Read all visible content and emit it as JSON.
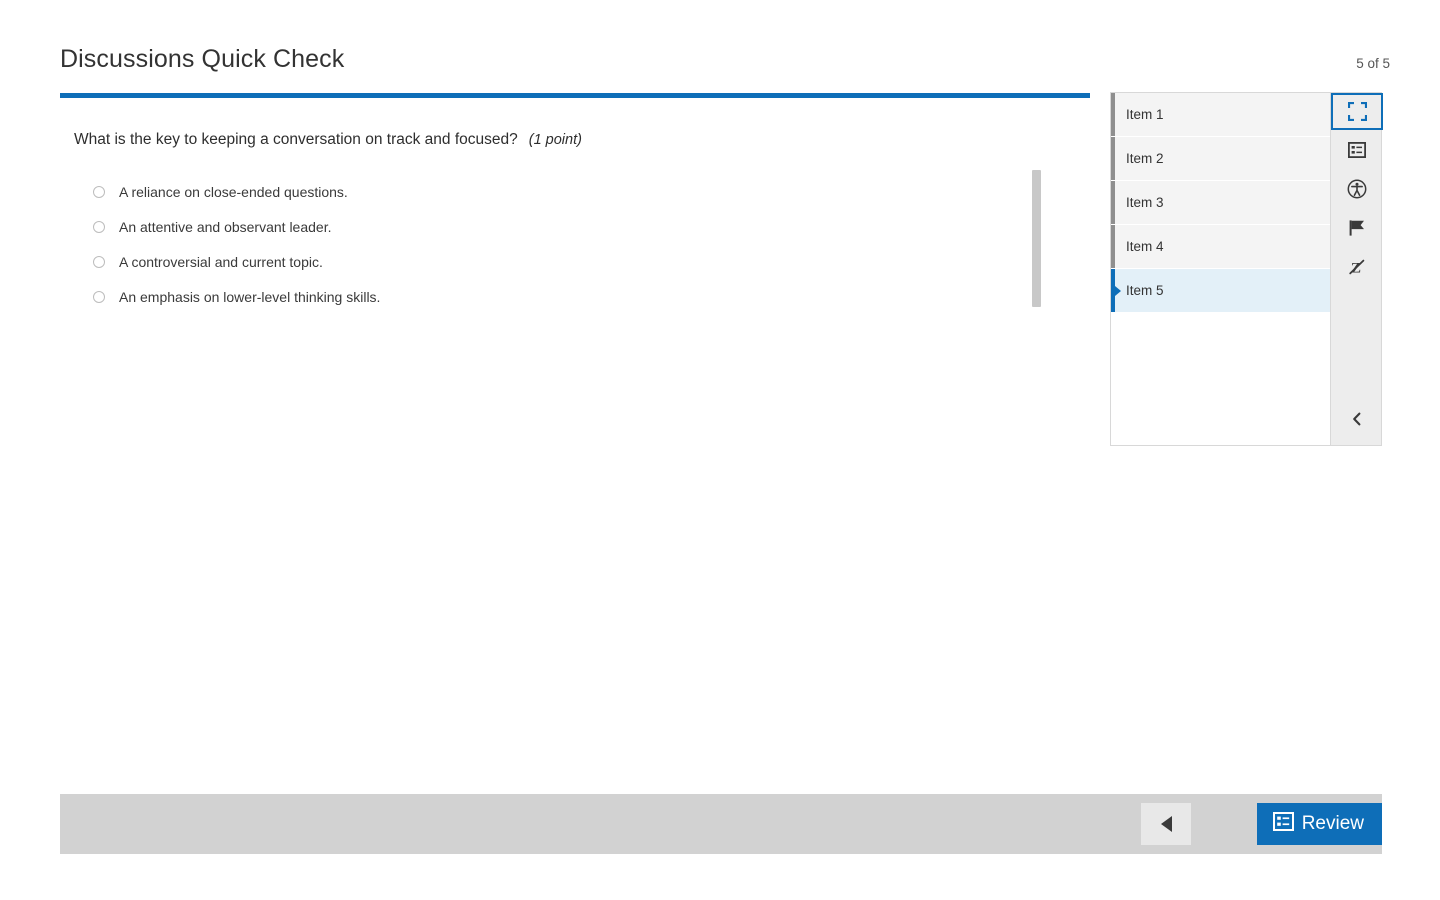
{
  "header": {
    "title": "Discussions Quick Check",
    "counter": "5 of 5"
  },
  "question": {
    "text": "What is the key to keeping a conversation on track and focused?",
    "points": "(1 point)",
    "options": [
      {
        "label": "A reliance on close-ended questions.",
        "selected": false
      },
      {
        "label": "An attentive and observant leader.",
        "selected": false
      },
      {
        "label": "A controversial and current topic.",
        "selected": false
      },
      {
        "label": "An emphasis on lower-level thinking skills.",
        "selected": false
      }
    ]
  },
  "nav_panel": {
    "items": [
      {
        "label": "Item 1",
        "selected": false
      },
      {
        "label": "Item 2",
        "selected": false
      },
      {
        "label": "Item 3",
        "selected": false
      },
      {
        "label": "Item 4",
        "selected": false
      },
      {
        "label": "Item 5",
        "selected": true
      }
    ],
    "tools": [
      {
        "name": "fullscreen-icon",
        "active": true
      },
      {
        "name": "review-list-icon",
        "active": false
      },
      {
        "name": "accessibility-icon",
        "active": false
      },
      {
        "name": "flag-icon",
        "active": false
      },
      {
        "name": "strikethrough-icon",
        "active": false
      }
    ],
    "collapse_icon": "chevron-left-icon"
  },
  "bottom_bar": {
    "prev_icon": "triangle-left-icon",
    "review_icon": "review-list-icon",
    "review_label": "Review"
  },
  "colors": {
    "accent": "#0E6EB8",
    "selected_row": "#E3F0F8",
    "bottom_bar": "#D2D2D2",
    "rail_bg": "#EDEDED"
  }
}
